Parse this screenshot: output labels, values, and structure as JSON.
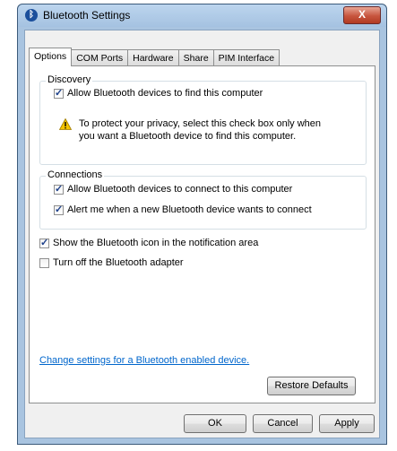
{
  "window": {
    "title": "Bluetooth Settings",
    "close_glyph": "X"
  },
  "tabs": [
    {
      "label": "Options",
      "active": true
    },
    {
      "label": "COM Ports",
      "active": false
    },
    {
      "label": "Hardware",
      "active": false
    },
    {
      "label": "Share",
      "active": false
    },
    {
      "label": "PIM Interface",
      "active": false
    }
  ],
  "discovery": {
    "legend": "Discovery",
    "allow_find_label": "Allow Bluetooth devices to find this computer",
    "allow_find_checked": true,
    "warning_line1": "To protect your privacy, select this check box only when",
    "warning_line2": "you want a Bluetooth device to find this computer."
  },
  "connections": {
    "legend": "Connections",
    "allow_connect_label": "Allow Bluetooth devices to connect to this computer",
    "allow_connect_checked": true,
    "alert_label": "Alert me when a new Bluetooth device wants to connect",
    "alert_checked": true
  },
  "options": {
    "show_icon_label": "Show the Bluetooth icon in the notification area",
    "show_icon_checked": true,
    "turn_off_label": "Turn off the Bluetooth adapter",
    "turn_off_checked": false
  },
  "link_text": "Change settings for a Bluetooth enabled device.",
  "buttons": {
    "restore_defaults": "Restore Defaults",
    "ok": "OK",
    "cancel": "Cancel",
    "apply": "Apply"
  },
  "colors": {
    "link": "#0066cc",
    "title_bar": "#a5c2e1",
    "close_button": "#c7553e"
  }
}
